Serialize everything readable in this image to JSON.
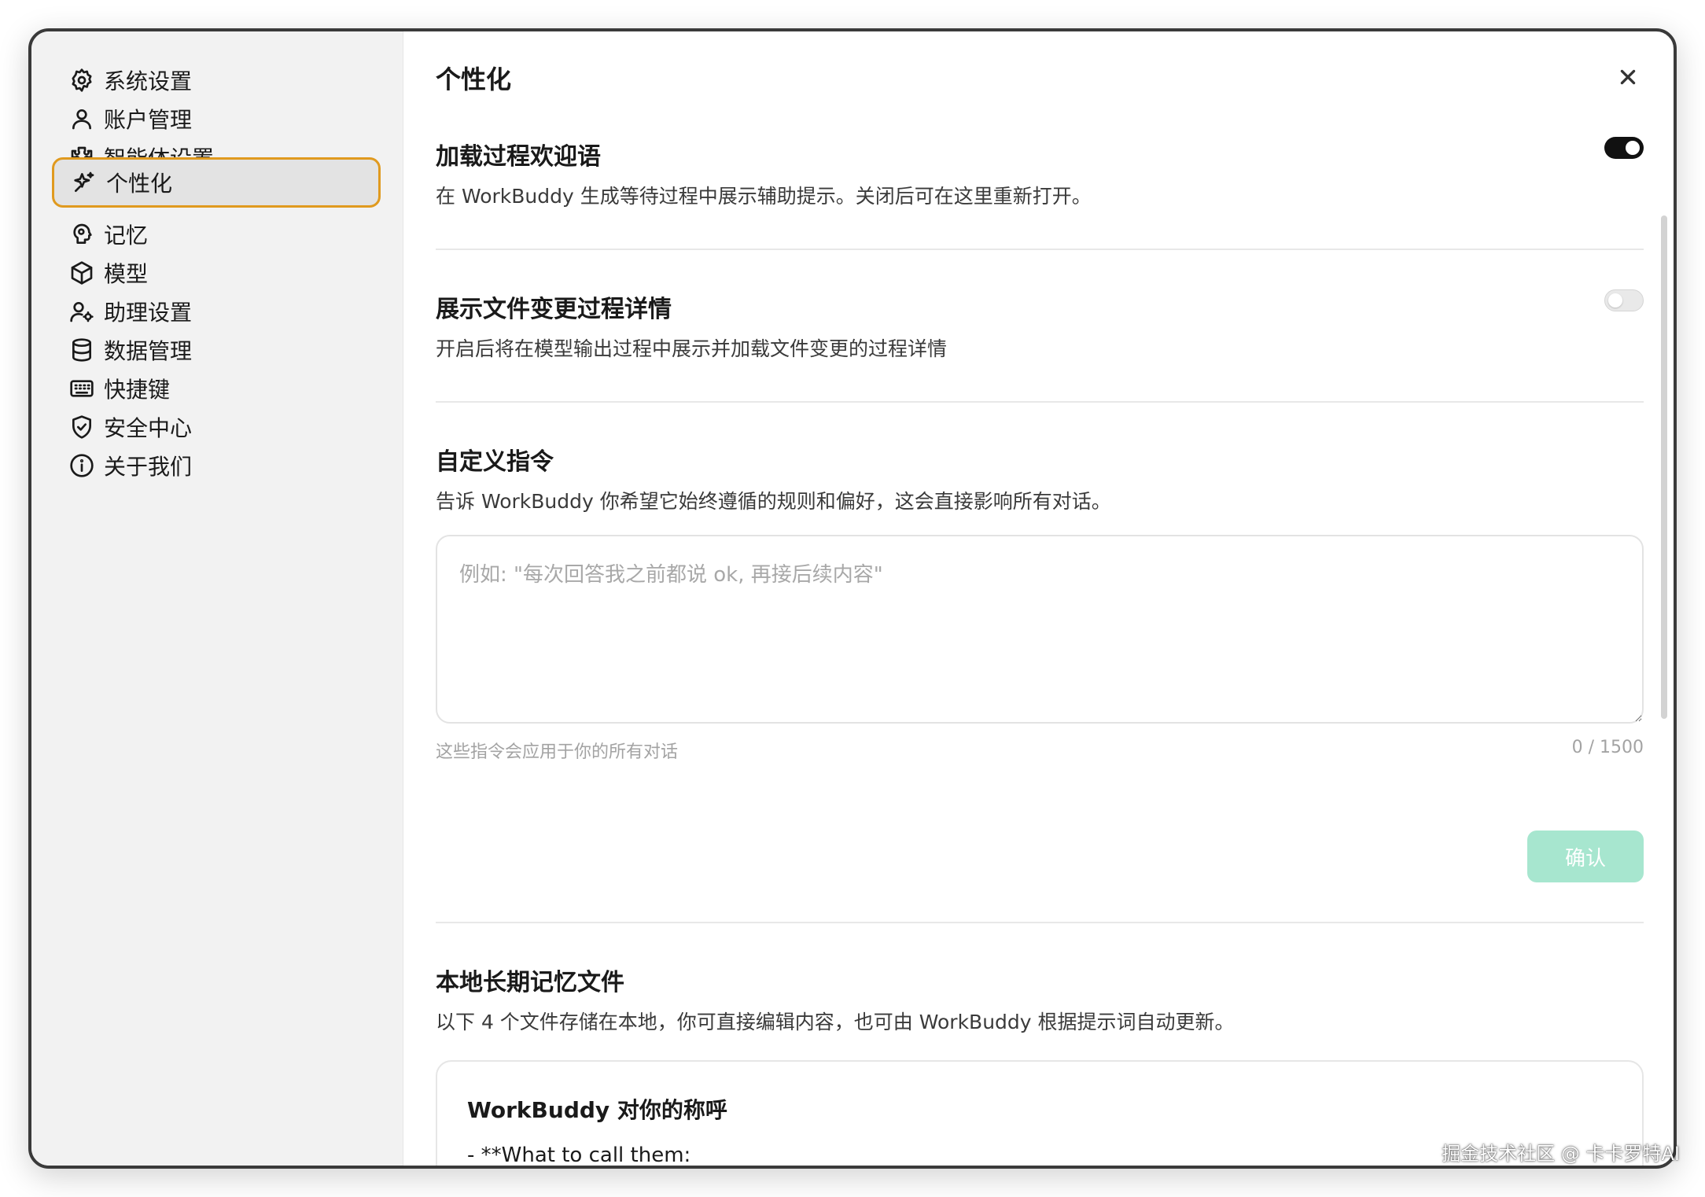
{
  "sidebar": {
    "items": [
      {
        "label": "系统设置",
        "icon": "gear-icon"
      },
      {
        "label": "账户管理",
        "icon": "user-icon"
      },
      {
        "label": "智能体设置",
        "icon": "puzzle-icon"
      },
      {
        "label": "个性化",
        "icon": "sparkle-icon",
        "active": true
      },
      {
        "label": "记忆",
        "icon": "brain-icon"
      },
      {
        "label": "模型",
        "icon": "cube-icon"
      },
      {
        "label": "助理设置",
        "icon": "user-gear-icon"
      },
      {
        "label": "数据管理",
        "icon": "database-icon"
      },
      {
        "label": "快捷键",
        "icon": "keyboard-icon"
      },
      {
        "label": "安全中心",
        "icon": "shield-icon"
      },
      {
        "label": "关于我们",
        "icon": "info-icon"
      }
    ]
  },
  "main": {
    "title": "个性化",
    "welcome": {
      "title": "加载过程欢迎语",
      "desc": "在 WorkBuddy 生成等待过程中展示辅助提示。关闭后可在这里重新打开。",
      "enabled": true
    },
    "file_changes": {
      "title": "展示文件变更过程详情",
      "desc": "开启后将在模型输出过程中展示并加载文件变更的过程详情",
      "enabled": false
    },
    "custom_instructions": {
      "title": "自定义指令",
      "desc": "告诉 WorkBuddy 你希望它始终遵循的规则和偏好，这会直接影响所有对话。",
      "value": "",
      "placeholder": "例如: \"每次回答我之前都说 ok, 再接后续内容\"",
      "hint": "这些指令会应用于你的所有对话",
      "counter": "0 / 1500",
      "confirm_label": "确认"
    },
    "memory_files": {
      "title": "本地长期记忆文件",
      "desc": "以下 4 个文件存储在本地，你可直接编辑内容，也可由 WorkBuddy 根据提示词自动更新。",
      "card_title": "WorkBuddy 对你的称呼",
      "card_line": "- **What to call them:"
    }
  },
  "watermark": "掘金技术社区 @ 卡卡罗特AI",
  "colors": {
    "active_border": "#e09a1f",
    "confirm_bg": "#a7e6cf",
    "toggle_on": "#111111",
    "sidebar_bg": "#f2f2f2"
  }
}
